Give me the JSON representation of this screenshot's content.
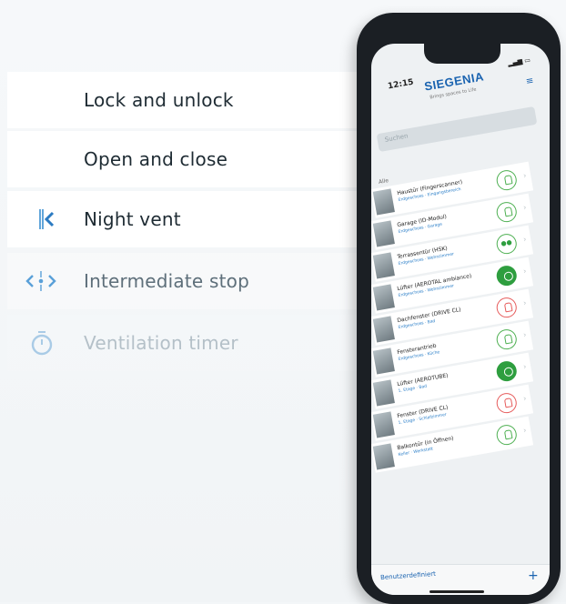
{
  "features": [
    {
      "label": "Lock and unlock",
      "icon": ""
    },
    {
      "label": "Open and close",
      "icon": ""
    },
    {
      "label": "Night vent",
      "icon": "night-vent-icon"
    },
    {
      "label": "Intermediate stop",
      "icon": "intermediate-stop-icon"
    },
    {
      "label": "Ventilation timer",
      "icon": "stopwatch-icon"
    }
  ],
  "colors": {
    "accent": "#3a8fd1",
    "text": "#1e2b33",
    "muted": "#5e6f7a",
    "faded": "#b4c0c8"
  },
  "phone": {
    "time": "12:15",
    "brand": "SIEGENIA",
    "tagline": "Brings spaces to Life",
    "search_placeholder": "Suchen",
    "list_header": "Alle",
    "rows": [
      {
        "name": "Haustür (Fingerscanner)",
        "sub": "Erdgeschoss · Eingangsbereich",
        "state": "green"
      },
      {
        "name": "Garage (ID-Modul)",
        "sub": "Erdgeschoss · Garage",
        "state": "green"
      },
      {
        "name": "Terrassentür (HSK)",
        "sub": "Erdgeschoss · Wohnzimmer",
        "state": "green-dots"
      },
      {
        "name": "Lüfter (AEROTAL ambiance)",
        "sub": "Erdgeschoss · Wohnzimmer",
        "state": "solid"
      },
      {
        "name": "Dachfenster (DRIVE CL)",
        "sub": "Erdgeschoss · Bad",
        "state": "red"
      },
      {
        "name": "Fensterantrieb",
        "sub": "Erdgeschoss · Küche",
        "state": "green"
      },
      {
        "name": "Lüfter (AEROTUBE)",
        "sub": "1. Etage · Bad",
        "state": "solid"
      },
      {
        "name": "Fenster (DRIVE CL)",
        "sub": "1. Etage · Schlafzimmer",
        "state": "red"
      },
      {
        "name": "Balkontür (in Öffnen)",
        "sub": "Keller · Werkstatt",
        "state": "green"
      }
    ],
    "sort_label": "Benutzerdefiniert",
    "add_label": "+"
  }
}
